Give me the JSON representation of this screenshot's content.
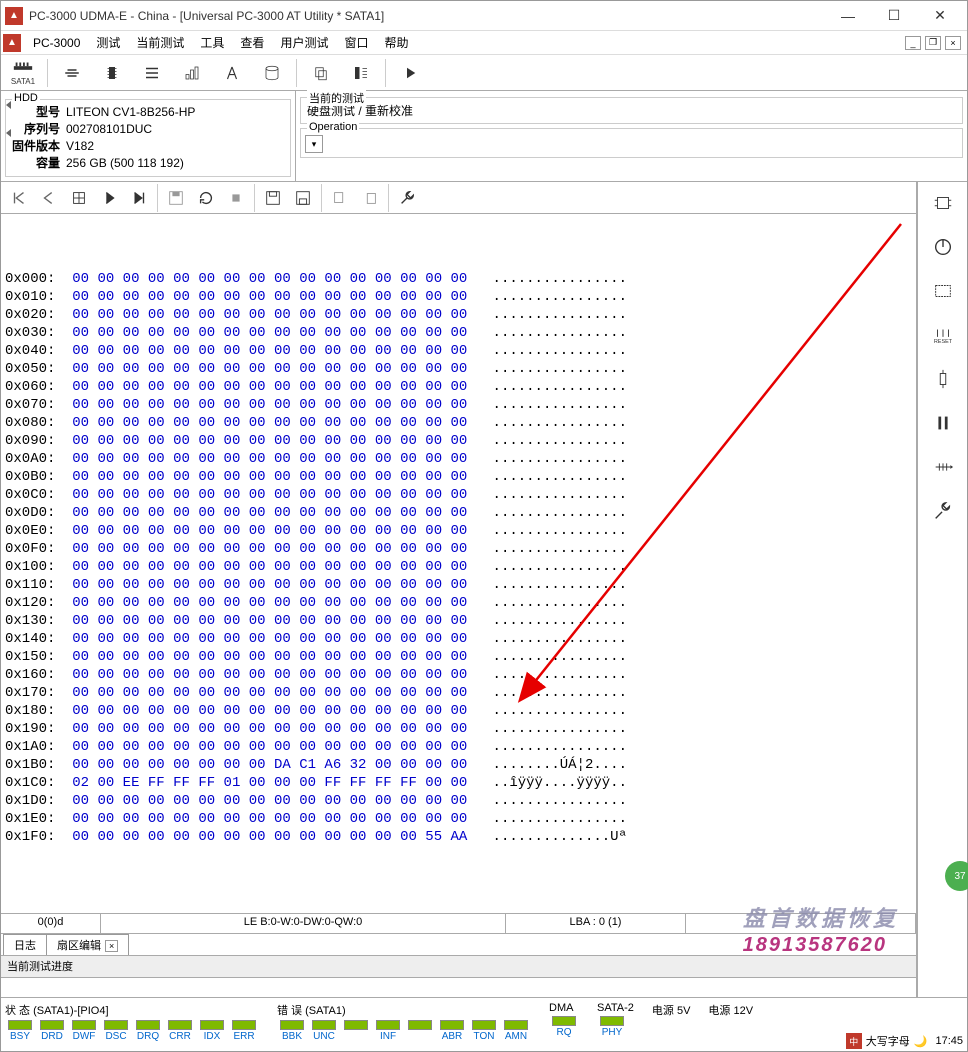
{
  "window": {
    "title": "PC-3000 UDMA-E - China - [Universal PC-3000 AT Utility * SATA1]"
  },
  "menu": {
    "items": [
      "PC-3000",
      "测试",
      "当前测试",
      "工具",
      "查看",
      "用户测试",
      "窗口",
      "帮助"
    ]
  },
  "toolbar1": {
    "port_label": "SATA1"
  },
  "hdd": {
    "group_title": "HDD",
    "model_label": "型号",
    "model": "LITEON CV1-8B256-HP",
    "serial_label": "序列号",
    "serial": "002708101DUC",
    "fw_label": "固件版本",
    "fw": "V182",
    "capacity_label": "容量",
    "capacity": "256 GB (500 118 192)"
  },
  "current_test": {
    "group_title": "当前的测试",
    "value": "硬盘测试 / 重新校准"
  },
  "operation": {
    "group_title": "Operation"
  },
  "hex": {
    "rows": [
      {
        "addr": "0x000:",
        "bytes": [
          "00",
          "00",
          "00",
          "00",
          "00",
          "00",
          "00",
          "00",
          "00",
          "00",
          "00",
          "00",
          "00",
          "00",
          "00",
          "00"
        ],
        "ascii": "................"
      },
      {
        "addr": "0x010:",
        "bytes": [
          "00",
          "00",
          "00",
          "00",
          "00",
          "00",
          "00",
          "00",
          "00",
          "00",
          "00",
          "00",
          "00",
          "00",
          "00",
          "00"
        ],
        "ascii": "................"
      },
      {
        "addr": "0x020:",
        "bytes": [
          "00",
          "00",
          "00",
          "00",
          "00",
          "00",
          "00",
          "00",
          "00",
          "00",
          "00",
          "00",
          "00",
          "00",
          "00",
          "00"
        ],
        "ascii": "................"
      },
      {
        "addr": "0x030:",
        "bytes": [
          "00",
          "00",
          "00",
          "00",
          "00",
          "00",
          "00",
          "00",
          "00",
          "00",
          "00",
          "00",
          "00",
          "00",
          "00",
          "00"
        ],
        "ascii": "................"
      },
      {
        "addr": "0x040:",
        "bytes": [
          "00",
          "00",
          "00",
          "00",
          "00",
          "00",
          "00",
          "00",
          "00",
          "00",
          "00",
          "00",
          "00",
          "00",
          "00",
          "00"
        ],
        "ascii": "................"
      },
      {
        "addr": "0x050:",
        "bytes": [
          "00",
          "00",
          "00",
          "00",
          "00",
          "00",
          "00",
          "00",
          "00",
          "00",
          "00",
          "00",
          "00",
          "00",
          "00",
          "00"
        ],
        "ascii": "................"
      },
      {
        "addr": "0x060:",
        "bytes": [
          "00",
          "00",
          "00",
          "00",
          "00",
          "00",
          "00",
          "00",
          "00",
          "00",
          "00",
          "00",
          "00",
          "00",
          "00",
          "00"
        ],
        "ascii": "................"
      },
      {
        "addr": "0x070:",
        "bytes": [
          "00",
          "00",
          "00",
          "00",
          "00",
          "00",
          "00",
          "00",
          "00",
          "00",
          "00",
          "00",
          "00",
          "00",
          "00",
          "00"
        ],
        "ascii": "................"
      },
      {
        "addr": "0x080:",
        "bytes": [
          "00",
          "00",
          "00",
          "00",
          "00",
          "00",
          "00",
          "00",
          "00",
          "00",
          "00",
          "00",
          "00",
          "00",
          "00",
          "00"
        ],
        "ascii": "................"
      },
      {
        "addr": "0x090:",
        "bytes": [
          "00",
          "00",
          "00",
          "00",
          "00",
          "00",
          "00",
          "00",
          "00",
          "00",
          "00",
          "00",
          "00",
          "00",
          "00",
          "00"
        ],
        "ascii": "................"
      },
      {
        "addr": "0x0A0:",
        "bytes": [
          "00",
          "00",
          "00",
          "00",
          "00",
          "00",
          "00",
          "00",
          "00",
          "00",
          "00",
          "00",
          "00",
          "00",
          "00",
          "00"
        ],
        "ascii": "................"
      },
      {
        "addr": "0x0B0:",
        "bytes": [
          "00",
          "00",
          "00",
          "00",
          "00",
          "00",
          "00",
          "00",
          "00",
          "00",
          "00",
          "00",
          "00",
          "00",
          "00",
          "00"
        ],
        "ascii": "................"
      },
      {
        "addr": "0x0C0:",
        "bytes": [
          "00",
          "00",
          "00",
          "00",
          "00",
          "00",
          "00",
          "00",
          "00",
          "00",
          "00",
          "00",
          "00",
          "00",
          "00",
          "00"
        ],
        "ascii": "................"
      },
      {
        "addr": "0x0D0:",
        "bytes": [
          "00",
          "00",
          "00",
          "00",
          "00",
          "00",
          "00",
          "00",
          "00",
          "00",
          "00",
          "00",
          "00",
          "00",
          "00",
          "00"
        ],
        "ascii": "................"
      },
      {
        "addr": "0x0E0:",
        "bytes": [
          "00",
          "00",
          "00",
          "00",
          "00",
          "00",
          "00",
          "00",
          "00",
          "00",
          "00",
          "00",
          "00",
          "00",
          "00",
          "00"
        ],
        "ascii": "................"
      },
      {
        "addr": "0x0F0:",
        "bytes": [
          "00",
          "00",
          "00",
          "00",
          "00",
          "00",
          "00",
          "00",
          "00",
          "00",
          "00",
          "00",
          "00",
          "00",
          "00",
          "00"
        ],
        "ascii": "................"
      },
      {
        "addr": "0x100:",
        "bytes": [
          "00",
          "00",
          "00",
          "00",
          "00",
          "00",
          "00",
          "00",
          "00",
          "00",
          "00",
          "00",
          "00",
          "00",
          "00",
          "00"
        ],
        "ascii": "................"
      },
      {
        "addr": "0x110:",
        "bytes": [
          "00",
          "00",
          "00",
          "00",
          "00",
          "00",
          "00",
          "00",
          "00",
          "00",
          "00",
          "00",
          "00",
          "00",
          "00",
          "00"
        ],
        "ascii": "................"
      },
      {
        "addr": "0x120:",
        "bytes": [
          "00",
          "00",
          "00",
          "00",
          "00",
          "00",
          "00",
          "00",
          "00",
          "00",
          "00",
          "00",
          "00",
          "00",
          "00",
          "00"
        ],
        "ascii": "................"
      },
      {
        "addr": "0x130:",
        "bytes": [
          "00",
          "00",
          "00",
          "00",
          "00",
          "00",
          "00",
          "00",
          "00",
          "00",
          "00",
          "00",
          "00",
          "00",
          "00",
          "00"
        ],
        "ascii": "................"
      },
      {
        "addr": "0x140:",
        "bytes": [
          "00",
          "00",
          "00",
          "00",
          "00",
          "00",
          "00",
          "00",
          "00",
          "00",
          "00",
          "00",
          "00",
          "00",
          "00",
          "00"
        ],
        "ascii": "................"
      },
      {
        "addr": "0x150:",
        "bytes": [
          "00",
          "00",
          "00",
          "00",
          "00",
          "00",
          "00",
          "00",
          "00",
          "00",
          "00",
          "00",
          "00",
          "00",
          "00",
          "00"
        ],
        "ascii": "................"
      },
      {
        "addr": "0x160:",
        "bytes": [
          "00",
          "00",
          "00",
          "00",
          "00",
          "00",
          "00",
          "00",
          "00",
          "00",
          "00",
          "00",
          "00",
          "00",
          "00",
          "00"
        ],
        "ascii": "................"
      },
      {
        "addr": "0x170:",
        "bytes": [
          "00",
          "00",
          "00",
          "00",
          "00",
          "00",
          "00",
          "00",
          "00",
          "00",
          "00",
          "00",
          "00",
          "00",
          "00",
          "00"
        ],
        "ascii": "................"
      },
      {
        "addr": "0x180:",
        "bytes": [
          "00",
          "00",
          "00",
          "00",
          "00",
          "00",
          "00",
          "00",
          "00",
          "00",
          "00",
          "00",
          "00",
          "00",
          "00",
          "00"
        ],
        "ascii": "................"
      },
      {
        "addr": "0x190:",
        "bytes": [
          "00",
          "00",
          "00",
          "00",
          "00",
          "00",
          "00",
          "00",
          "00",
          "00",
          "00",
          "00",
          "00",
          "00",
          "00",
          "00"
        ],
        "ascii": "................"
      },
      {
        "addr": "0x1A0:",
        "bytes": [
          "00",
          "00",
          "00",
          "00",
          "00",
          "00",
          "00",
          "00",
          "00",
          "00",
          "00",
          "00",
          "00",
          "00",
          "00",
          "00"
        ],
        "ascii": "................"
      },
      {
        "addr": "0x1B0:",
        "bytes": [
          "00",
          "00",
          "00",
          "00",
          "00",
          "00",
          "00",
          "00",
          "DA",
          "C1",
          "A6",
          "32",
          "00",
          "00",
          "00",
          "00"
        ],
        "ascii": "........ÚÁ¦2...."
      },
      {
        "addr": "0x1C0:",
        "bytes": [
          "02",
          "00",
          "EE",
          "FF",
          "FF",
          "FF",
          "01",
          "00",
          "00",
          "00",
          "FF",
          "FF",
          "FF",
          "FF",
          "00",
          "00"
        ],
        "ascii": "..îÿÿÿ....ÿÿÿÿ.."
      },
      {
        "addr": "0x1D0:",
        "bytes": [
          "00",
          "00",
          "00",
          "00",
          "00",
          "00",
          "00",
          "00",
          "00",
          "00",
          "00",
          "00",
          "00",
          "00",
          "00",
          "00"
        ],
        "ascii": "................"
      },
      {
        "addr": "0x1E0:",
        "bytes": [
          "00",
          "00",
          "00",
          "00",
          "00",
          "00",
          "00",
          "00",
          "00",
          "00",
          "00",
          "00",
          "00",
          "00",
          "00",
          "00"
        ],
        "ascii": "................"
      },
      {
        "addr": "0x1F0:",
        "bytes": [
          "00",
          "00",
          "00",
          "00",
          "00",
          "00",
          "00",
          "00",
          "00",
          "00",
          "00",
          "00",
          "00",
          "00",
          "55",
          "AA"
        ],
        "ascii": "..............Uª"
      }
    ]
  },
  "status1": {
    "cell1": "0(0)d",
    "cell2": "LE B:0-W:0-DW:0-QW:0",
    "cell3": "LBA : 0 (1)"
  },
  "tabs": {
    "log": "日志",
    "sector": "扇区编辑"
  },
  "progress": {
    "label": "当前测试进度"
  },
  "status_bottom": {
    "state_title": "状 态 (SATA1)-[PIO4]",
    "state_leds": [
      "BSY",
      "DRD",
      "DWF",
      "DSC",
      "DRQ",
      "CRR",
      "IDX",
      "ERR"
    ],
    "error_title": "错 误 (SATA1)",
    "error_leds": [
      "BBK",
      "UNC",
      "",
      "INF",
      "",
      "ABR",
      "TON",
      "AMN"
    ],
    "dma_title": "DMA",
    "dma_leds": [
      "RQ"
    ],
    "sata_title": "SATA-2",
    "sata_leds": [
      "PHY"
    ],
    "power5_title": "电源 5V",
    "power12_title": "电源 12V"
  },
  "watermark": {
    "line1": "盘首数据恢复",
    "line2": "18913587620"
  },
  "badge": "37",
  "taskbar": {
    "text": "大写字母",
    "time": "17:45"
  }
}
